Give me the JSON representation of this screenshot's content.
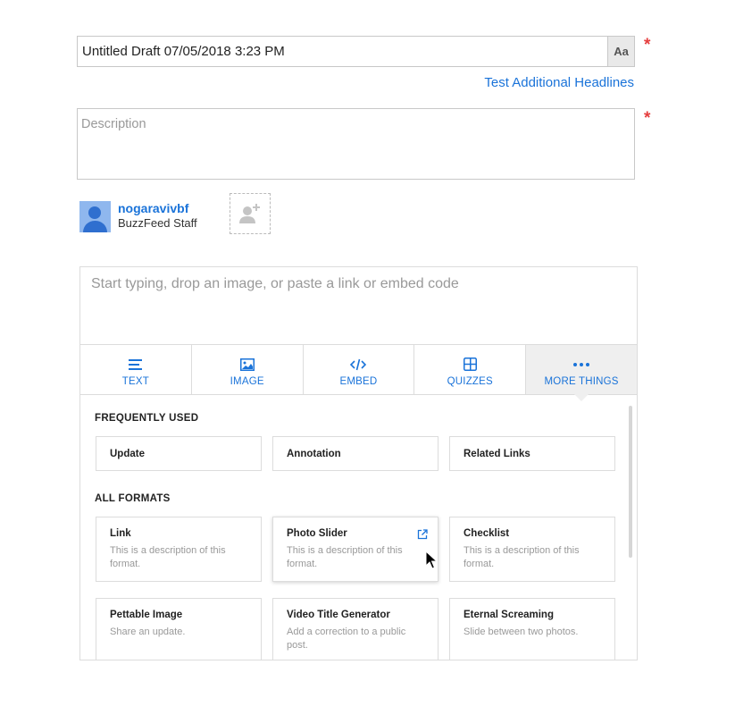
{
  "headline": {
    "value": "Untitled Draft 07/05/2018 3:23 PM",
    "format_button_label": "Aa",
    "required_mark": "*"
  },
  "test_headlines_link": "Test Additional Headlines",
  "description": {
    "placeholder": "Description",
    "required_mark": "*"
  },
  "author": {
    "name": "nogaravivbf",
    "role": "BuzzFeed Staff"
  },
  "editor": {
    "placeholder": "Start typing, drop an image, or paste a link or embed code"
  },
  "toolbar": {
    "buttons": [
      {
        "label": "TEXT",
        "icon": "text-lines-icon"
      },
      {
        "label": "IMAGE",
        "icon": "image-icon"
      },
      {
        "label": "EMBED",
        "icon": "code-icon"
      },
      {
        "label": "QUIZZES",
        "icon": "grid-icon"
      },
      {
        "label": "MORE THINGS",
        "icon": "more-dots-icon",
        "active": true
      }
    ]
  },
  "formats_panel": {
    "frequently_used_title": "FREQUENTLY USED",
    "frequently_used": [
      "Update",
      "Annotation",
      "Related Links"
    ],
    "all_formats_title": "ALL FORMATS",
    "all_formats": [
      {
        "title": "Link",
        "description": "This is a description of this format."
      },
      {
        "title": "Photo Slider",
        "description": "This is a description of this format."
      },
      {
        "title": "Checklist",
        "description": "This is a description of this format."
      },
      {
        "title": "Pettable Image",
        "description": "Share an update."
      },
      {
        "title": "Video Title Generator",
        "description": "Add a correction to a public post."
      },
      {
        "title": "Eternal Screaming",
        "description": "Slide between two photos."
      }
    ]
  },
  "colors": {
    "accent": "#1a73d9",
    "required": "#e53e3e",
    "border": "#dcdcdc"
  }
}
